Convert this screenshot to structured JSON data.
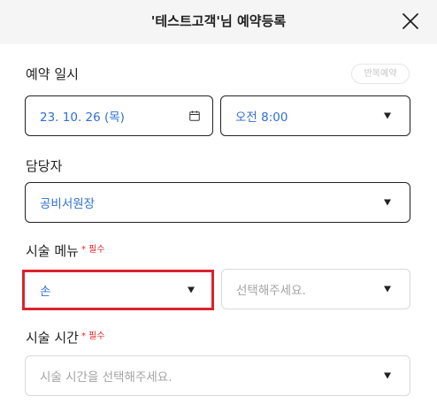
{
  "header": {
    "title": "'테스트고객'님 예약등록"
  },
  "reservation_datetime": {
    "label": "예약 일시",
    "repeat_button_label": "반복예약",
    "date_value": "23. 10. 26 (목)",
    "time_value": "오전 8:00"
  },
  "manager": {
    "label": "담당자",
    "value": "공비서원장"
  },
  "menu": {
    "label": "시술 메뉴",
    "required_tag": "* 필수",
    "category_value": "손",
    "item_placeholder": "선택해주세요."
  },
  "duration": {
    "label": "시술 시간",
    "required_tag": "* 필수",
    "placeholder": "시술 시간을 선택해주세요."
  },
  "colors": {
    "accent_text": "#2f6fd6",
    "required": "#e0242f",
    "highlight": "#d9232d",
    "header_bg": "#f5f5f6"
  }
}
